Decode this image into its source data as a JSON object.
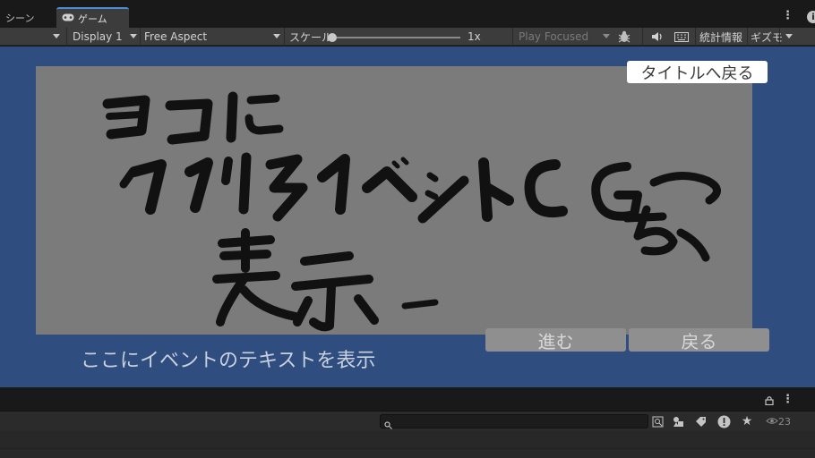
{
  "tabs": {
    "scene_label": "シーン",
    "game_label": "ゲーム"
  },
  "toolbar": {
    "display": "Display 1",
    "aspect": "Free Aspect",
    "scale_label": "スケール",
    "scale_value": "1x",
    "play_mode": "Play Focused",
    "stats": "統計情報",
    "gizmos": "ギズモ"
  },
  "game": {
    "title_button": "タイトルへ戻る",
    "next_button": "進む",
    "back_button": "戻る",
    "event_text": "ここにイベントのテキストを表示",
    "placeholder_handwriting": "ココにクリスイベントCGを表示"
  },
  "lower": {
    "visibility_count": "23"
  },
  "colors": {
    "game_background": "#304d7f",
    "cg_placeholder": "#7b7b7b",
    "active_tab_accent": "#4a8cd8"
  }
}
